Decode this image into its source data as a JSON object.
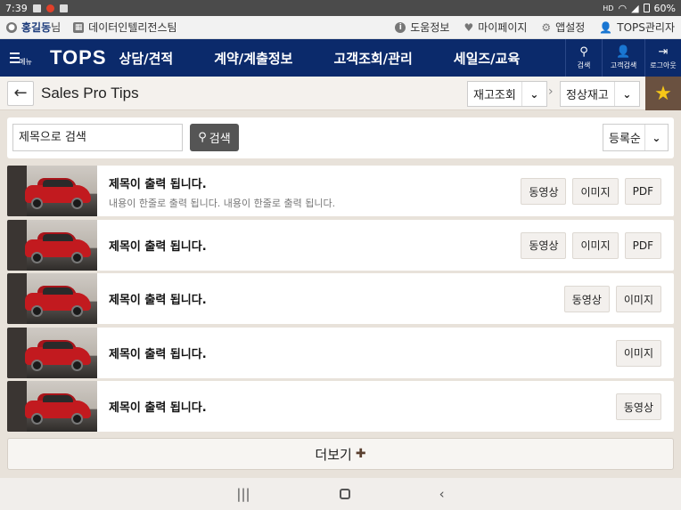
{
  "status_bar": {
    "time": "7:39",
    "signal_label": "HD",
    "battery": "60%"
  },
  "util_bar": {
    "user_name": "홍길동",
    "user_suffix": "님",
    "org_name": "데이터인텔리전스팀",
    "help": "도움정보",
    "mypage": "마이페이지",
    "app_settings": "앱설정",
    "admin": "TOPS관리자"
  },
  "navbar": {
    "menu_label": "메뉴",
    "logo": "TOPS",
    "items": [
      "상담/견적",
      "계약/계출정보",
      "고객조회/관리",
      "세일즈/교육"
    ],
    "icons": {
      "search": "검색",
      "customer_search": "고객검색",
      "logout": "로그아웃"
    }
  },
  "subheader": {
    "title": "Sales Pro Tips",
    "crumb1": "재고조회",
    "crumb2": "정상재고"
  },
  "search": {
    "placeholder": "제목으로 검색",
    "button": "검색",
    "sort": "등록순"
  },
  "list": [
    {
      "title": "제목이 출력 됩니다.",
      "desc": "내용이 한줄로 출력 됩니다. 내용이 한줄로 출력 됩니다.",
      "buttons": [
        "동영상",
        "이미지",
        "PDF"
      ]
    },
    {
      "title": "제목이 출력 됩니다.",
      "desc": "",
      "buttons": [
        "동영상",
        "이미지",
        "PDF"
      ]
    },
    {
      "title": "제목이 출력 됩니다.",
      "desc": "",
      "buttons": [
        "동영상",
        "이미지"
      ]
    },
    {
      "title": "제목이 출력 됩니다.",
      "desc": "",
      "buttons": [
        "이미지"
      ]
    },
    {
      "title": "제목이 출력 됩니다.",
      "desc": "",
      "buttons": [
        "동영상"
      ]
    }
  ],
  "more_button": "더보기",
  "colors": {
    "nav_bg": "#0b2a6b",
    "favorite_bg": "#6a5140",
    "star": "#f6c718",
    "search_btn": "#555555"
  }
}
